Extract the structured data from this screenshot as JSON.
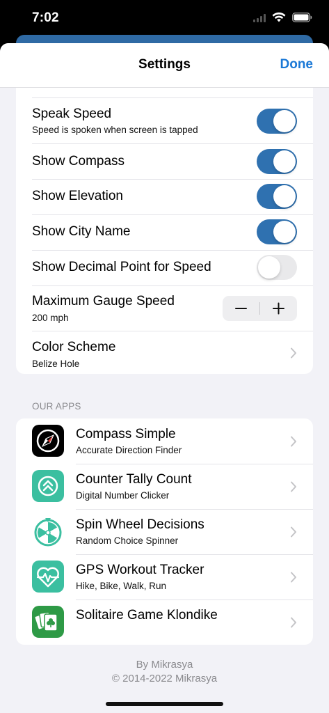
{
  "status_bar": {
    "time": "7:02"
  },
  "nav": {
    "title": "Settings",
    "done_label": "Done"
  },
  "settings": [
    {
      "title": "Speak Speed",
      "subtitle": "Speed is spoken when screen is tapped",
      "control": "toggle",
      "on": true
    },
    {
      "title": "Show Compass",
      "control": "toggle",
      "on": true
    },
    {
      "title": "Show Elevation",
      "control": "toggle",
      "on": true
    },
    {
      "title": "Show City Name",
      "control": "toggle",
      "on": true
    },
    {
      "title": "Show Decimal Point for Speed",
      "control": "toggle",
      "on": false
    },
    {
      "title": "Maximum Gauge Speed",
      "subtitle": "200 mph",
      "control": "stepper",
      "minus": "−",
      "plus": "+"
    },
    {
      "title": "Color Scheme",
      "subtitle": "Belize Hole",
      "control": "chevron"
    }
  ],
  "apps_section": {
    "header": "OUR APPS",
    "items": [
      {
        "title": "Compass Simple",
        "subtitle": "Accurate Direction Finder",
        "icon": "compass-app-icon"
      },
      {
        "title": "Counter Tally Count",
        "subtitle": "Digital Number Clicker",
        "icon": "counter-app-icon"
      },
      {
        "title": "Spin Wheel Decisions",
        "subtitle": "Random Choice Spinner",
        "icon": "spin-wheel-app-icon"
      },
      {
        "title": "GPS Workout Tracker",
        "subtitle": "Hike, Bike, Walk, Run",
        "icon": "workout-app-icon"
      },
      {
        "title": "Solitaire Game Klondike",
        "icon": "solitaire-app-icon"
      }
    ]
  },
  "footer": {
    "line1": "By Mikrasya",
    "line2": "© 2014-2022 Mikrasya"
  },
  "colors": {
    "accent": "#1a78d6",
    "toggle_on": "#2f71b0",
    "background": "#f2f2f7",
    "app_teal": "#3bbfa0",
    "app_green": "#2e9a46"
  }
}
